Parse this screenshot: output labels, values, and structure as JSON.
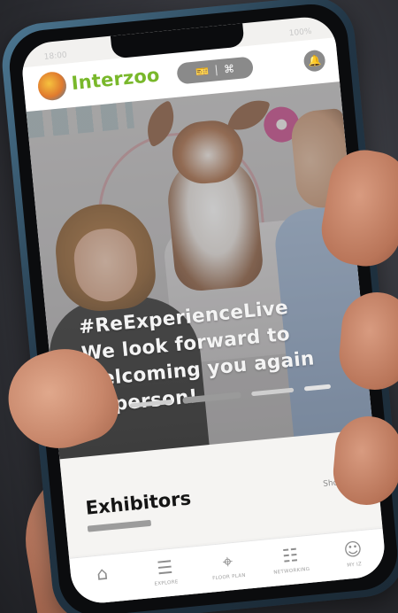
{
  "status_bar": {
    "time": "18:00",
    "battery": "100%"
  },
  "header": {
    "brand_name": "Interzoo",
    "brand_color": "#79b82b"
  },
  "hero": {
    "lines": [
      "#ReExperienceLive",
      "We look forward to",
      "welcoming you again",
      "in person!"
    ],
    "carousel_count": 5,
    "active_index": 2
  },
  "exhibitors": {
    "title": "Exhibitors",
    "show_all": "Show all"
  },
  "nav": {
    "items": [
      {
        "label": "",
        "icon": "home-icon"
      },
      {
        "label": "EXPLORE",
        "icon": "search-list-icon"
      },
      {
        "label": "FLOOR PLAN",
        "icon": "map-pin-icon"
      },
      {
        "label": "NETWORKING",
        "icon": "handshake-icon"
      },
      {
        "label": "MY IZ",
        "icon": "profile-icon"
      }
    ]
  }
}
